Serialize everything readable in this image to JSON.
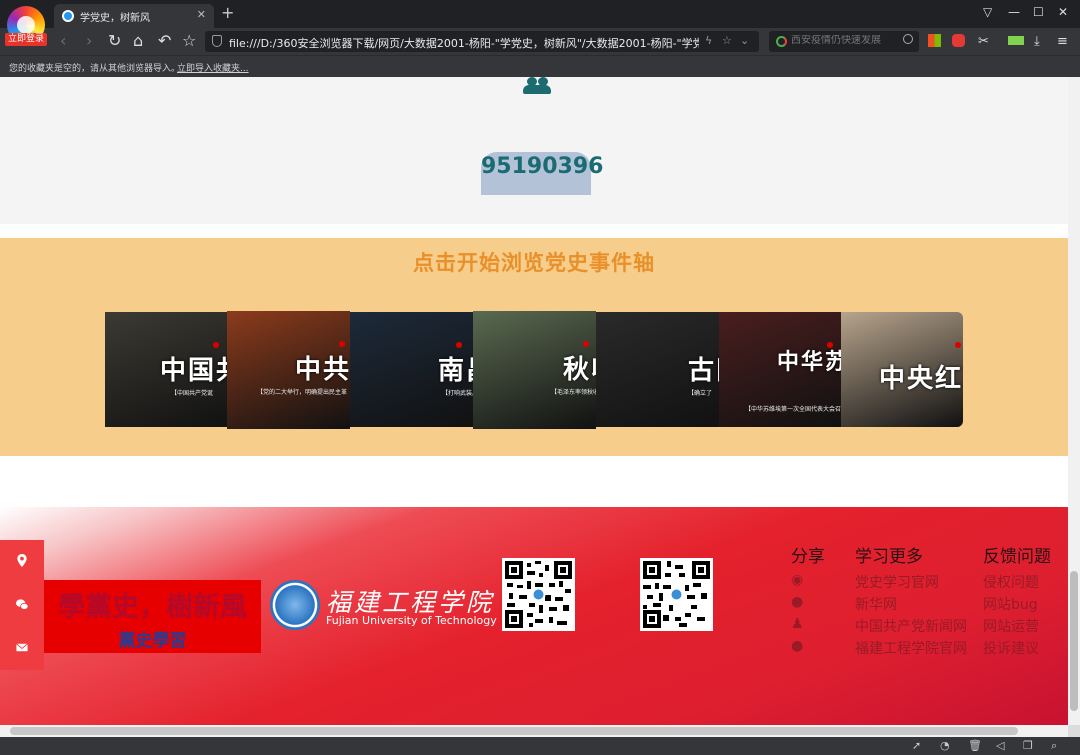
{
  "browser": {
    "login_badge": "立即登录",
    "tab_title": "学党史，树新风",
    "new_tab": "+",
    "url": "file:///D:/360安全浏览器下载/网页/大数据2001-杨阳-\"学党史，树新风\"/大数据2001-杨阳-\"学党史，树",
    "search_placeholder": "西安疫情仍快速发展",
    "bookmarks_text": "您的收藏夹是空的，请从其他浏览器导入。",
    "bookmarks_link": "立即导入收藏夹..."
  },
  "counter": {
    "value": "95190396"
  },
  "timeline": {
    "title": "点击开始浏览党史事件轴",
    "cards": [
      {
        "text": "中国共",
        "sub": "【中国共产党诞",
        "color": "#3c3a33"
      },
      {
        "text": "中共",
        "sub": "【党的二大举行，明确提出民主革",
        "color": "#8c3b1c"
      },
      {
        "text": "南昌",
        "sub": "【打响武装反抗",
        "color": "#1d2a3a"
      },
      {
        "text": "秋收",
        "sub": "【毛泽东率领秋收起义",
        "color": "#5a6a50"
      },
      {
        "text": "古田",
        "sub": "【确立了",
        "color": "#2a2a2a"
      },
      {
        "text": "中华苏维",
        "sub": "【中华苏维埃第一次全国代表大会召开",
        "color": "#4a1e1e"
      },
      {
        "text": "中央红军",
        "sub": "",
        "color": "#b7a48c"
      }
    ]
  },
  "footer": {
    "brand_title": "學黨史，樹新風",
    "brand_sub": "黨史學習",
    "school_cn": "福建工程学院",
    "school_en": "Fujian University of Technology",
    "share": {
      "title": "分享",
      "icons": [
        "weibo-icon",
        "wechat-icon",
        "qq-icon",
        "chat-icon"
      ]
    },
    "learn_more": {
      "title": "学习更多",
      "links": [
        "党史学习官网",
        "新华网",
        "中国共产党新闻网",
        "福建工程学院官网"
      ]
    },
    "feedback": {
      "title": "反馈问题",
      "links": [
        "侵权问题",
        "网站bug",
        "网站运营",
        "投诉建议"
      ]
    },
    "side_icons": [
      "location-icon",
      "wechat-icon",
      "mail-icon"
    ]
  }
}
